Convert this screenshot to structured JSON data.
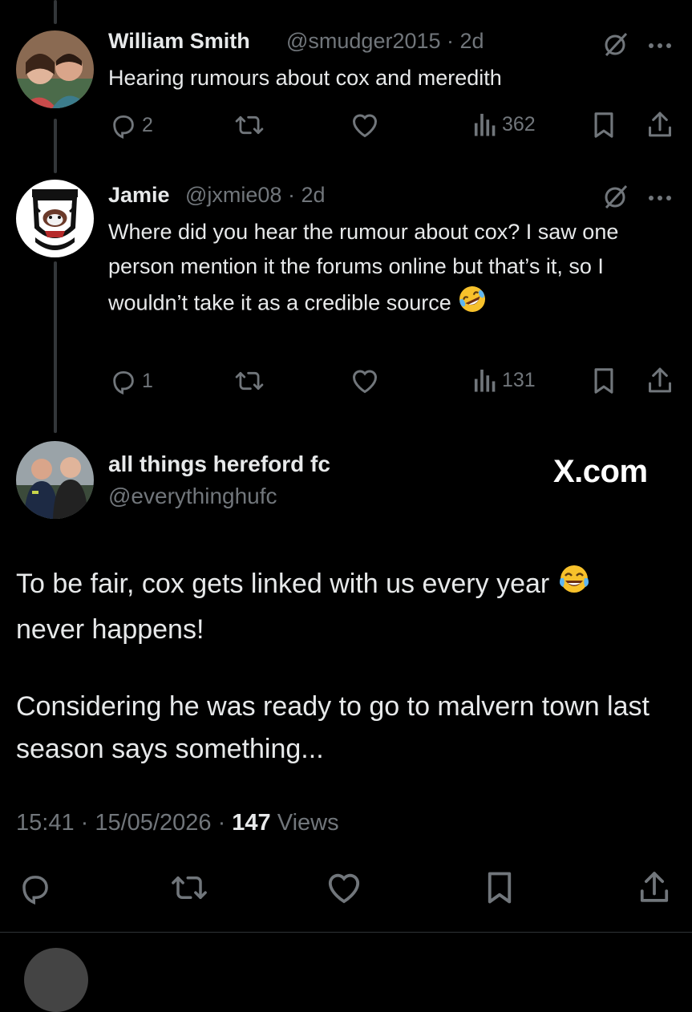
{
  "reply1": {
    "name": "William Smith",
    "handle": "@smudger2015",
    "sep": " · ",
    "time": "2d",
    "text": "Hearing rumours about cox and meredith",
    "replies": "2",
    "reposts": "",
    "likes": "",
    "views": "362"
  },
  "reply2": {
    "name": "Jamie",
    "handle": "@jxmie08",
    "sep": " · ",
    "time": "2d",
    "text": "Where did you hear the rumour about cox? I saw one person mention it the forums online but that’s it, so I wouldn’t take it as a credible source",
    "emoji": "rolling-on-floor-laughing",
    "avatar_badge_top": "HEREFORD FC",
    "avatar_badge_bottom": "FOREVER UNITED",
    "replies": "1",
    "reposts": "",
    "likes": "",
    "views": "131"
  },
  "main": {
    "name": "all things hereford fc",
    "handle": "@everythinghufc",
    "watermark": "X.com",
    "paragraph1": "To be fair, cox gets linked with us every year",
    "paragraph1_end": "never happens!",
    "paragraph2": "Considering he was ready to go to malvern town last season says something...",
    "emoji": "face-with-tears-of-joy",
    "time": "15:41",
    "date": "15/05/2026",
    "views_count": "147",
    "views_label": "Views"
  },
  "colors": {
    "background": "#000000",
    "text": "#e7e9ea",
    "muted": "#71767b",
    "thread_line": "#333639"
  }
}
